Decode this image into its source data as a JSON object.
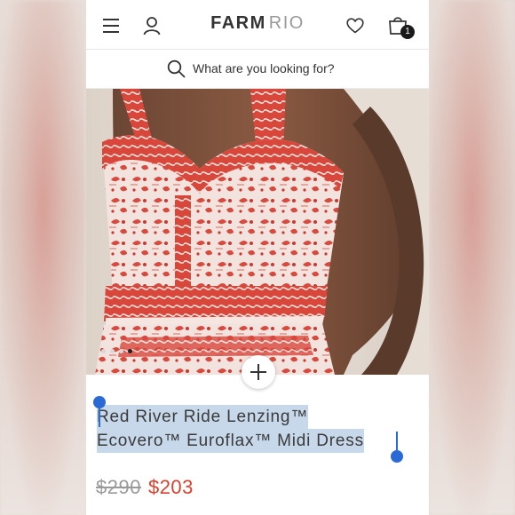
{
  "header": {
    "brand_primary": "FARM",
    "brand_secondary": "RIO",
    "cart_count": "1",
    "icons": [
      "menu-icon",
      "user-icon",
      "heart-icon",
      "bag-icon"
    ]
  },
  "search": {
    "placeholder": "What are you looking for?"
  },
  "gallery": {
    "slide_count": 4,
    "active_slide": 3
  },
  "product": {
    "title_line_1": "Red River Ride Lenzing™",
    "title_line_2": "Ecovero™ Euroflax™ Midi Dress",
    "old_price": "$290",
    "new_price": "$203"
  },
  "colors": {
    "sale_price": "#d9412f",
    "selection_highlight": "#c7d8eb",
    "selection_handle": "#2a6ad7"
  }
}
